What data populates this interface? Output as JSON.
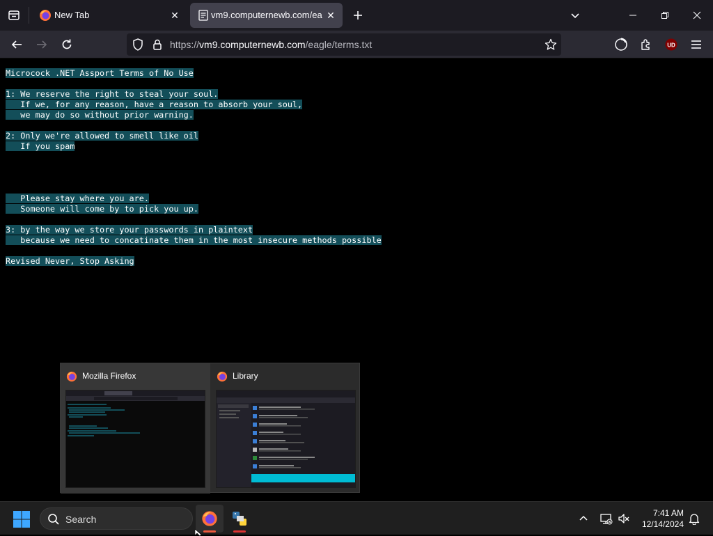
{
  "browser": {
    "tabs": [
      {
        "title": "New Tab",
        "active": false
      },
      {
        "title": "vm9.computernewb.com/eagle/terms.txt",
        "active": true
      }
    ],
    "url": {
      "prefix": "https://",
      "host": "vm9.computernewb.com",
      "path": "/eagle/terms.txt"
    },
    "extension_badge": "UD"
  },
  "document_lines": [
    "Microcock .NET Assport Terms of No Use",
    "",
    "1: We reserve the right to steal your soul.",
    "   If we, for any reason, have a reason to absorb your soul,",
    "   we may do so without prior warning.",
    "",
    "2: Only we're allowed to smell like oil",
    "   If you spam",
    "",
    "",
    "",
    "",
    "   Please stay where you are.",
    "   Someone will come by to pick you up.",
    "",
    "3: by the way we store your passwords in plaintext",
    "   because we need to concatinate them in the most insecure methods possible",
    "",
    "Revised Never, Stop Asking"
  ],
  "thumbnails": [
    {
      "title": "Mozilla Firefox"
    },
    {
      "title": "Library"
    }
  ],
  "taskbar": {
    "search_placeholder": "Search",
    "time": "7:41 AM",
    "date": "12/14/2024"
  },
  "colors": {
    "highlight": "#134e59",
    "firefox_orange": "#ff7139",
    "accent_cyan": "#00bcd4"
  }
}
